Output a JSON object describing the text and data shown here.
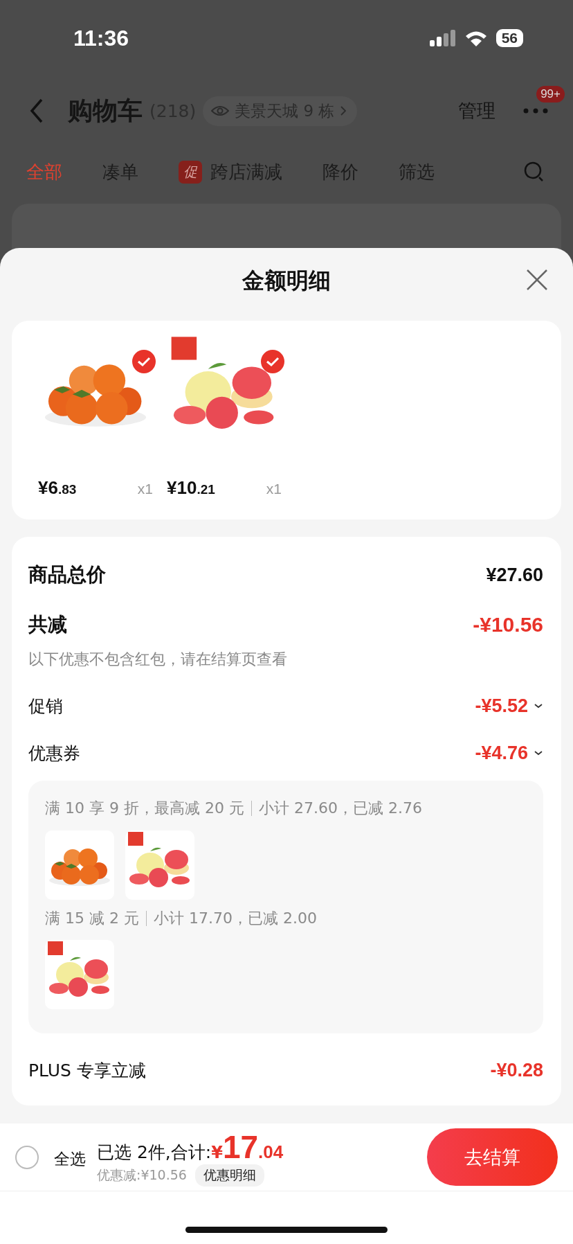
{
  "status_bar": {
    "time": "11:36",
    "battery": "56"
  },
  "nav": {
    "title": "购物车",
    "count": "(218)",
    "location": "美景天城 9 栋",
    "manage": "管理",
    "badge": "99+"
  },
  "tabs": [
    {
      "label": "全部",
      "selected": true
    },
    {
      "label": "凑单",
      "selected": false
    },
    {
      "label": "跨店满减",
      "selected": false,
      "tag": "促"
    },
    {
      "label": "降价",
      "selected": false
    },
    {
      "label": "筛选",
      "selected": false
    }
  ],
  "sheet": {
    "title": "金额明细",
    "products": [
      {
        "kind": "picture",
        "checked": true,
        "price": "¥6",
        "cents": ".83",
        "qty": "x1"
      },
      {
        "kind": "picture",
        "checked": true,
        "price": "¥10",
        "cents": ".21",
        "qty": "x1"
      }
    ],
    "rows": [
      {
        "kind": "total",
        "label": "商品总价",
        "value": "¥27.60"
      },
      {
        "kind": "discount",
        "label": "共减",
        "value": "-¥10.56",
        "note": "以下优惠不包含红包，请在结算页查看"
      },
      {
        "kind": "collapsible",
        "label": "促销",
        "value": "-¥5.52"
      },
      {
        "kind": "collapsible",
        "label": "优惠券",
        "value": "-¥4.76"
      }
    ],
    "coupon_groups": [
      {
        "rule": "满 10 享 9 折，最高减 20 元",
        "subtotal": "小计 27.60，已减 2.76"
      },
      {
        "rule": "满 15 减 2 元",
        "subtotal": "小计 17.70，已减 2.00"
      }
    ],
    "plus": {
      "label": "PLUS 专享立减",
      "value": "-¥0.28"
    }
  },
  "bottom_bar": {
    "select_all": {
      "label": "全选",
      "checked": false
    },
    "summary": "已选 2件,合计:",
    "currency": "¥",
    "total": "17",
    "cents": ".04",
    "discount": "优惠减:¥10.56",
    "detail_button": "优惠明细",
    "checkout": "去结算"
  }
}
